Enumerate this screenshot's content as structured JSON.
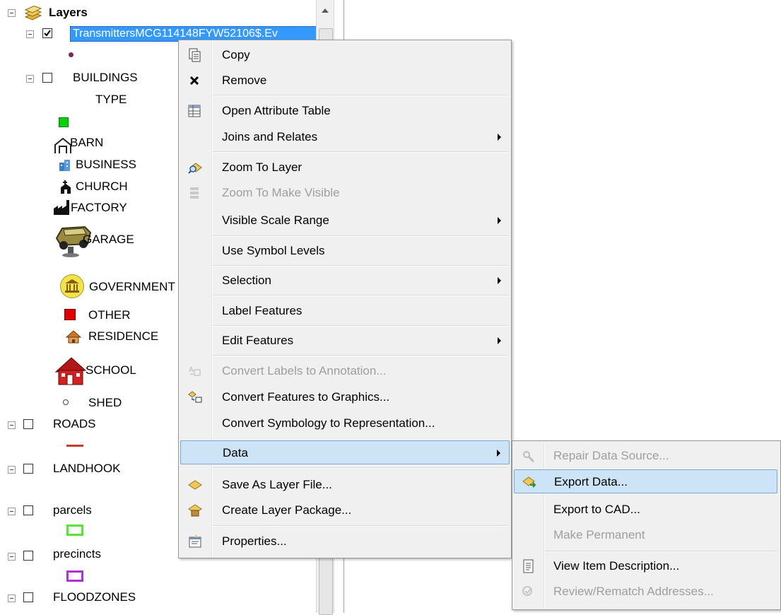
{
  "toc": {
    "root_label": "Layers",
    "selected_layer": "TransmittersMCG114148FYW52106$.Ev",
    "buildings": {
      "name": "BUILDINGS",
      "field": "TYPE",
      "classes": [
        "BARN",
        "BUSINESS",
        "CHURCH",
        "FACTORY",
        "GARAGE",
        "GOVERNMENT",
        "OTHER",
        "RESIDENCE",
        "SCHOOL",
        "SHED"
      ]
    },
    "layers": [
      "ROADS",
      "LANDHOOK",
      "parcels",
      "precincts",
      "FLOODZONES"
    ]
  },
  "context_menu": {
    "items": [
      {
        "label": "Copy",
        "icon": "copy-icon",
        "enabled": true
      },
      {
        "label": "Remove",
        "icon": "remove-x-icon",
        "enabled": true
      },
      {
        "label": "Open Attribute Table",
        "icon": "table-icon",
        "enabled": true
      },
      {
        "label": "Joins and Relates",
        "submenu": true,
        "enabled": true
      },
      {
        "label": "Zoom To Layer",
        "icon": "zoom-to-layer-icon",
        "enabled": true
      },
      {
        "label": "Zoom To Make Visible",
        "icon": "zoom-to-make-visible-icon",
        "enabled": false
      },
      {
        "label": "Visible Scale Range",
        "submenu": true,
        "enabled": true
      },
      {
        "label": "Use Symbol Levels",
        "enabled": true
      },
      {
        "label": "Selection",
        "submenu": true,
        "enabled": true
      },
      {
        "label": "Label Features",
        "enabled": true
      },
      {
        "label": "Edit Features",
        "submenu": true,
        "enabled": true
      },
      {
        "label": "Convert Labels to Annotation...",
        "icon": "convert-labels-icon",
        "enabled": false
      },
      {
        "label": "Convert Features to Graphics...",
        "icon": "convert-graphics-icon",
        "enabled": true
      },
      {
        "label": "Convert Symbology to Representation...",
        "enabled": true
      },
      {
        "label": "Data",
        "submenu": true,
        "enabled": true,
        "highlighted": true
      },
      {
        "label": "Save As Layer File...",
        "icon": "layer-file-icon",
        "enabled": true
      },
      {
        "label": "Create Layer Package...",
        "icon": "layer-package-icon",
        "enabled": true
      },
      {
        "label": "Properties...",
        "icon": "properties-icon",
        "enabled": true
      }
    ]
  },
  "data_submenu": {
    "items": [
      {
        "label": "Repair Data Source...",
        "icon": "repair-icon",
        "enabled": false
      },
      {
        "label": "Export Data...",
        "icon": "export-icon",
        "enabled": true,
        "highlighted": true
      },
      {
        "label": "Export to CAD...",
        "enabled": true
      },
      {
        "label": "Make Permanent",
        "enabled": false
      },
      {
        "label": "View Item Description...",
        "icon": "description-icon",
        "enabled": true
      },
      {
        "label": "Review/Rematch Addresses...",
        "icon": "rematch-icon",
        "enabled": false
      }
    ]
  },
  "colors": {
    "selection_blue": "#3399ff",
    "menu_highlight": "#cde4f7",
    "disabled_text": "#9e9e9e",
    "buildings_default": "#00d400",
    "other_red": "#e00000",
    "roads_red": "#c83c2c",
    "parcels_green": "#55e635",
    "precincts_purple": "#b32fd6"
  }
}
